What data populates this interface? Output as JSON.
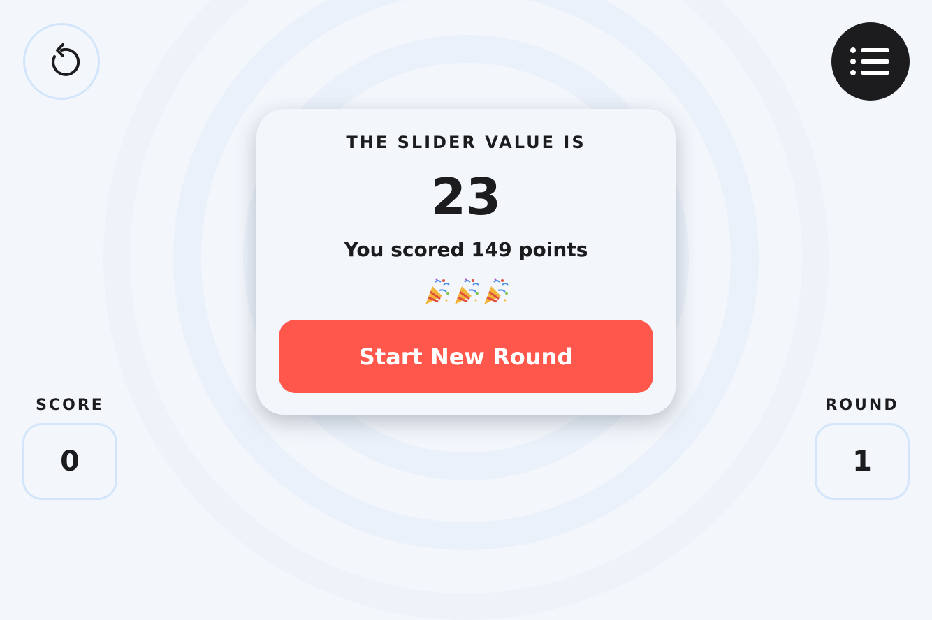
{
  "card": {
    "label": "THE SLIDER VALUE IS",
    "value": "23",
    "message": "You scored 149 points",
    "button_label": "Start New Round"
  },
  "score": {
    "label": "SCORE",
    "value": "0"
  },
  "round": {
    "label": "ROUND",
    "value": "1"
  },
  "icons": {
    "restart": "restart-icon",
    "menu": "list-icon",
    "celebration": "party-popper-icon"
  },
  "colors": {
    "background": "#f3f7fc",
    "accent": "#ff574c",
    "dark": "#1c1c1e",
    "border": "#d3e5fb"
  }
}
